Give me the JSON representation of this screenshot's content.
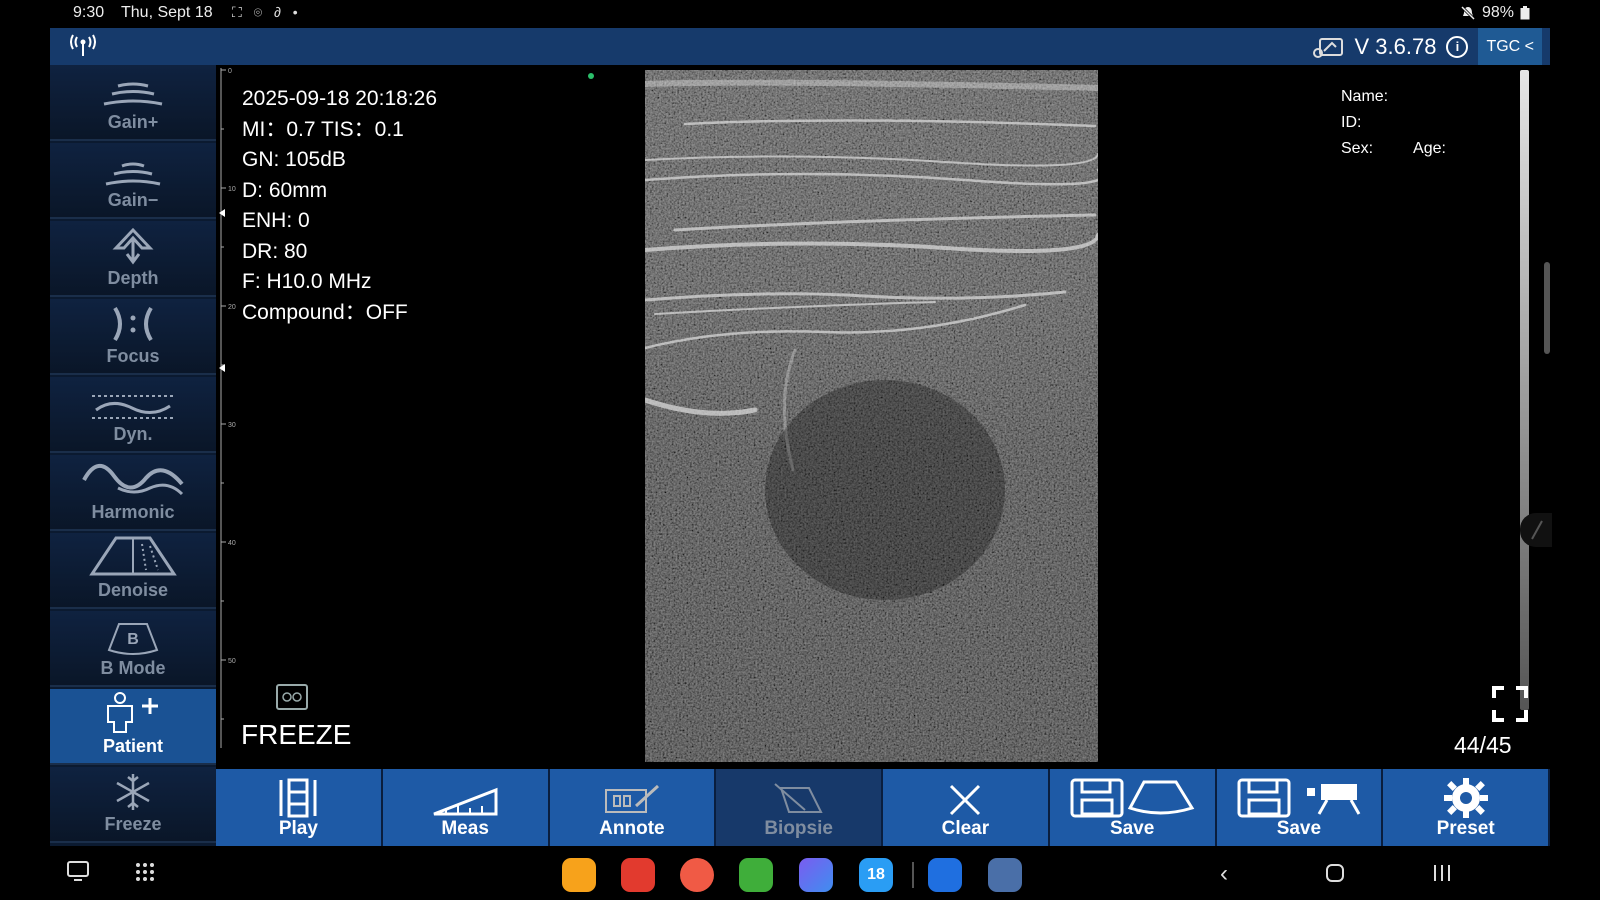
{
  "status_bar": {
    "time": "9:30",
    "date": "Thu, Sept 18",
    "notification_icons": "⛶ ⌾ ∂ •",
    "mute_icon": "bell-mute-icon",
    "battery": "98%"
  },
  "header": {
    "version": "V 3.6.78",
    "tgc_label": "TGC <",
    "accent": "#163a6b"
  },
  "sidebar": {
    "items": [
      {
        "label": "Gain+",
        "icon": "gain-plus-icon"
      },
      {
        "label": "Gain−",
        "icon": "gain-minus-icon"
      },
      {
        "label": "Depth",
        "icon": "depth-icon"
      },
      {
        "label": "Focus",
        "icon": "focus-icon"
      },
      {
        "label": "Dyn.",
        "icon": "dynamic-range-icon"
      },
      {
        "label": "Harmonic",
        "icon": "harmonic-icon"
      },
      {
        "label": "Denoise",
        "icon": "denoise-icon"
      },
      {
        "label": "B Mode",
        "icon": "b-mode-icon"
      },
      {
        "label": "Patient",
        "icon": "patient-icon",
        "active": true
      },
      {
        "label": "Freeze",
        "icon": "snowflake-icon"
      }
    ]
  },
  "scale": {
    "labels": [
      "0",
      "10",
      "20",
      "30",
      "40",
      "50"
    ]
  },
  "params": {
    "datetime": "2025-09-18 20:18:26",
    "mi_tis": "MI：0.7  TIS：0.1",
    "gn": "GN: 105dB",
    "depth": "D: 60mm",
    "enh": "ENH: 0",
    "dr": "DR: 80",
    "freq": "F: H10.0 MHz",
    "compound": "Compound：OFF"
  },
  "patient": {
    "name_label": "Name:",
    "id_label": "ID:",
    "sex_label": "Sex:",
    "age_label": "Age:"
  },
  "status": {
    "freeze": "FREEZE",
    "frame_count": "44/45"
  },
  "toolbar": {
    "items": [
      {
        "label": "Play",
        "icon": "play-icon"
      },
      {
        "label": "Meas",
        "icon": "ruler-icon"
      },
      {
        "label": "Annote",
        "icon": "annotate-icon"
      },
      {
        "label": "Biopsie",
        "icon": "biopsy-icon",
        "dim": true
      },
      {
        "label": "Clear",
        "icon": "clear-icon"
      },
      {
        "label": "Save",
        "icon": "save-image-icon"
      },
      {
        "label": "Save",
        "icon": "save-video-icon"
      },
      {
        "label": "Preset",
        "icon": "gear-icon"
      }
    ]
  },
  "navbar": {
    "apps": [
      "files-app-icon",
      "notes-app-icon",
      "contacts-app-icon",
      "calculator-app-icon",
      "browser-app-icon",
      "calendar-app-icon",
      "ultrasound-app-icon",
      "settings-app-icon"
    ],
    "calendar_day": "18"
  }
}
